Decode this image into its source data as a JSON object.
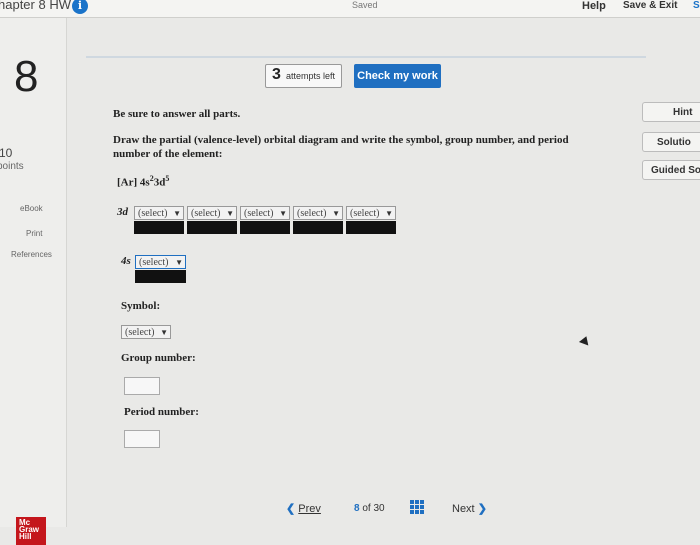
{
  "topbar": {
    "chapter_title": "hapter 8 HW",
    "info_icon": "info-icon",
    "status": "Saved",
    "help_label": "Help",
    "save_exit_label": "Save & Exit",
    "edge_text": "S"
  },
  "sidebar": {
    "question_number": "8",
    "points_value": "10",
    "points_label": "points",
    "links": [
      "eBook",
      "Print",
      "References"
    ],
    "logo_text": "Mc Graw Hill"
  },
  "attempts": {
    "count": "3",
    "label": "attempts left"
  },
  "check_button": "Check my work",
  "instruction": "Be sure to answer all parts.",
  "question": "Draw the partial (valence-level) orbital diagram and write the symbol, group number, and period number of the element:",
  "configuration": {
    "core": "[Ar]",
    "s_label": "4s",
    "s_exp": "2",
    "d_label": "3d",
    "d_exp": "5"
  },
  "orbitals": {
    "d_label": "3d",
    "d_selects": [
      "(select)",
      "(select)",
      "(select)",
      "(select)",
      "(select)"
    ],
    "s_label": "4s",
    "s_select": "(select)"
  },
  "symbol": {
    "label": "Symbol:",
    "select": "(select)"
  },
  "group": {
    "label": "Group number:"
  },
  "period": {
    "label": "Period number:"
  },
  "right_tabs": {
    "hint": "Hint",
    "solution": "Solutio",
    "guided": "Guided So"
  },
  "nav": {
    "prev": "Prev",
    "current": "8",
    "of": "of",
    "total": "30",
    "next": "Next"
  },
  "colors": {
    "accent": "#1f6fc1",
    "logo": "#c4161c"
  }
}
